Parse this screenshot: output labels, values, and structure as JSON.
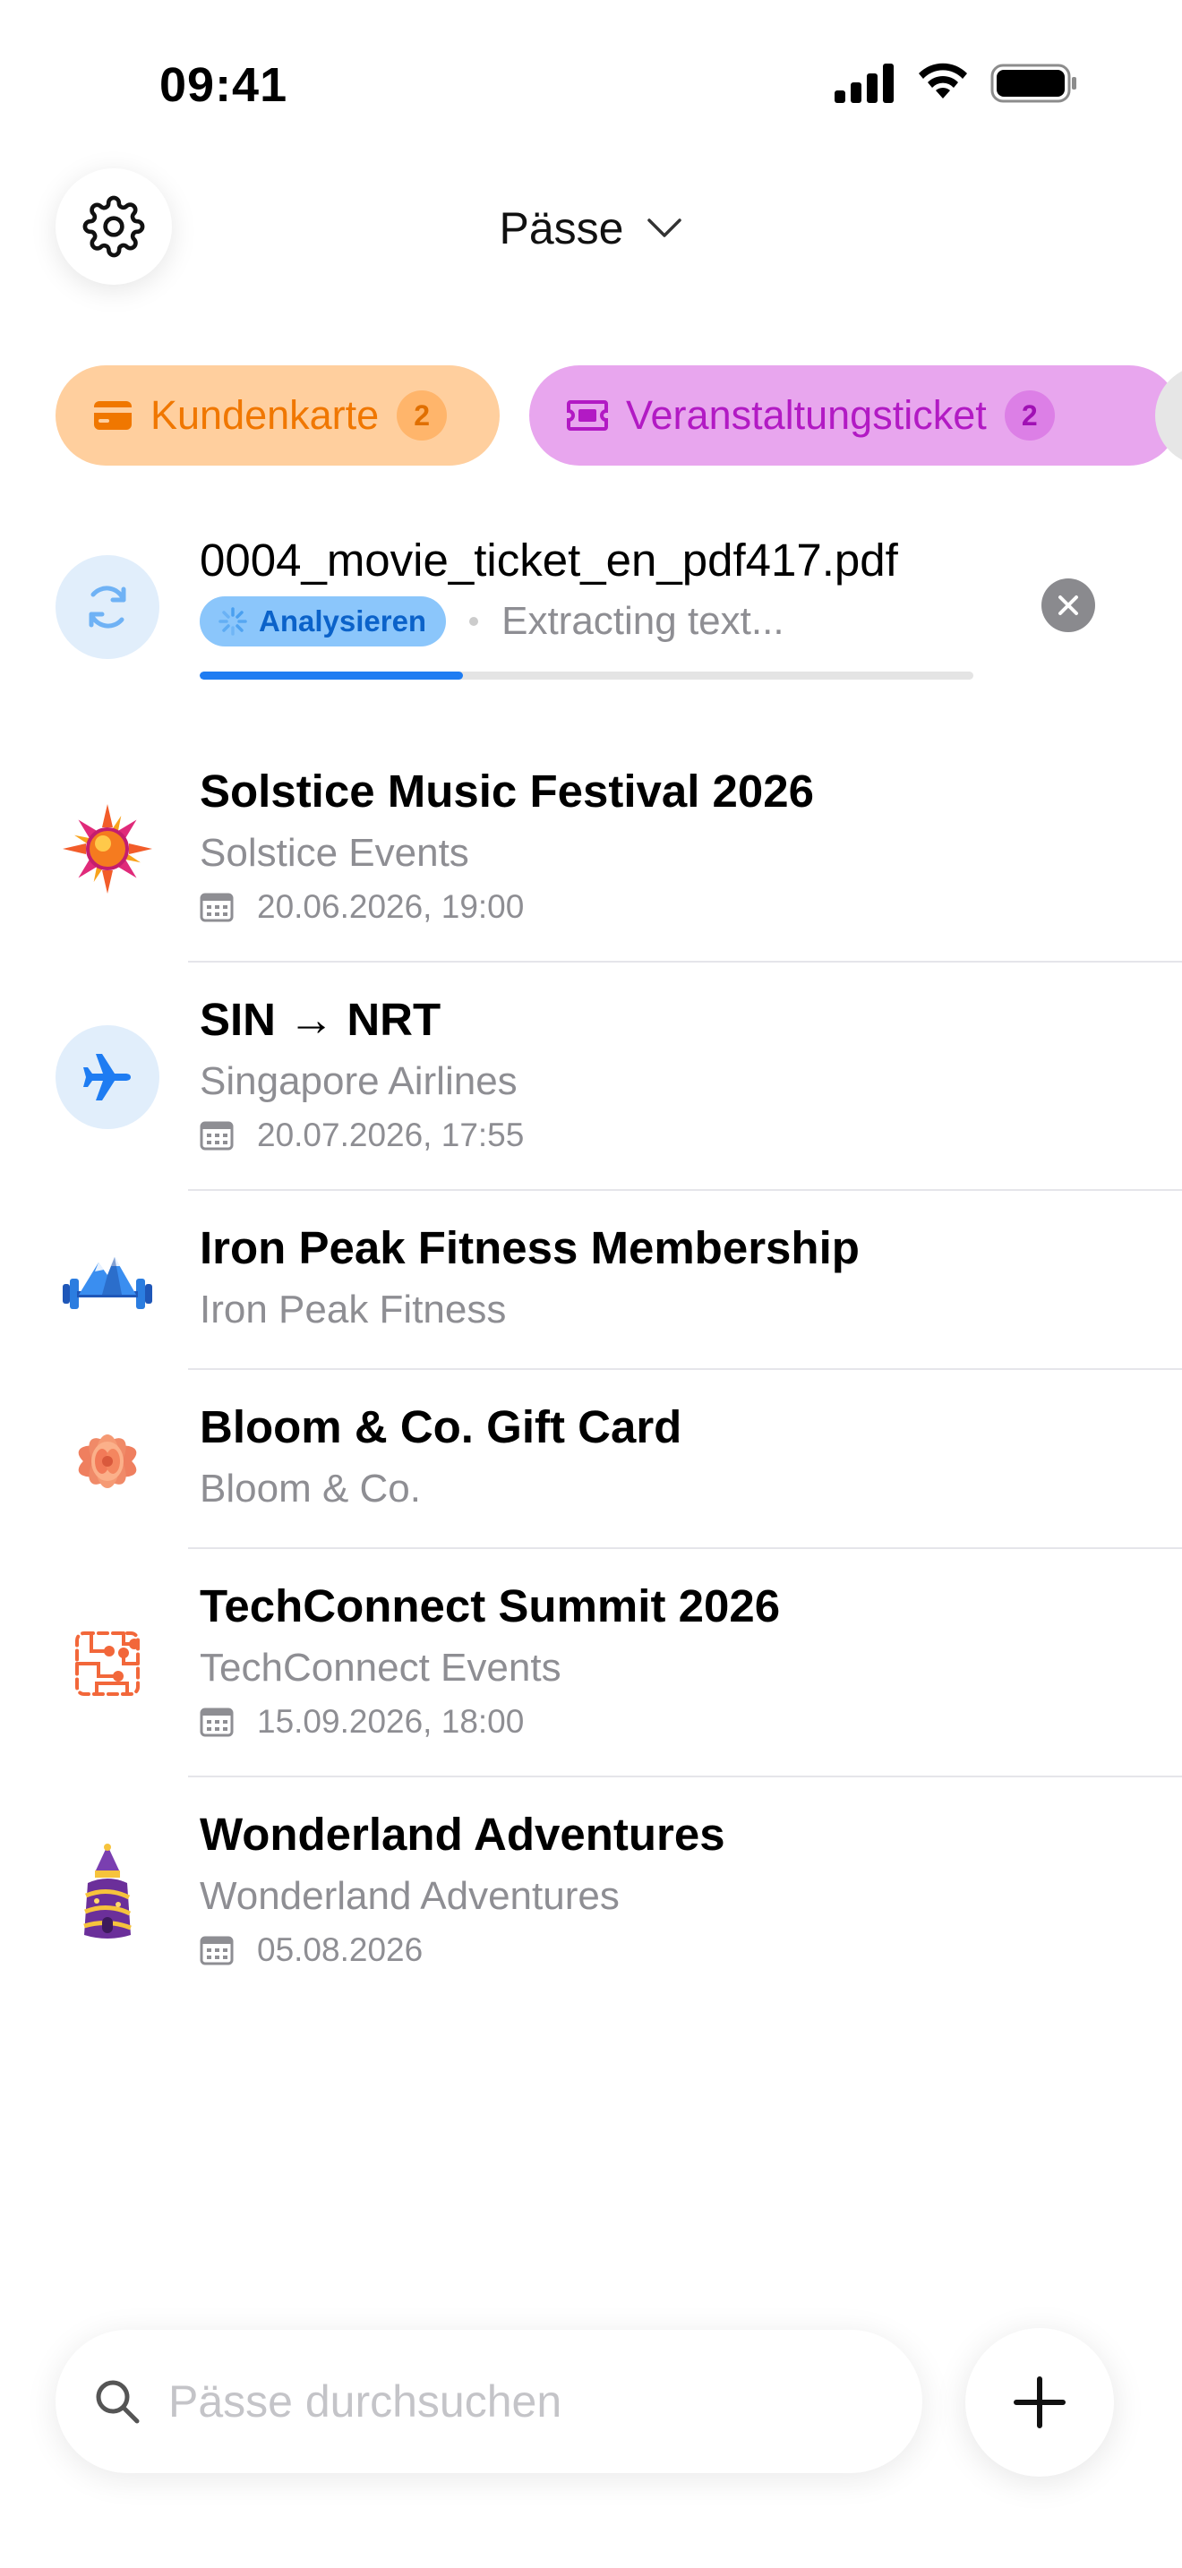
{
  "status_bar": {
    "time": "09:41"
  },
  "header": {
    "title": "Pässe"
  },
  "filters": [
    {
      "label": "Kundenkarte",
      "count": "2"
    },
    {
      "label": "Veranstaltungsticket",
      "count": "2"
    }
  ],
  "processing": {
    "filename": "0004_movie_ticket_en_pdf417.pdf",
    "badge": "Analysieren",
    "detail": "Extracting text...",
    "progress_percent": 34
  },
  "passes": [
    {
      "title": "Solstice Music Festival 2026",
      "subtitle": "Solstice Events",
      "date": "20.06.2026, 19:00",
      "icon": "sun-logo-icon"
    },
    {
      "title": "SIN → NRT",
      "subtitle": "Singapore Airlines",
      "date": "20.07.2026, 17:55",
      "icon": "airplane-icon"
    },
    {
      "title": "Iron Peak Fitness Membership",
      "subtitle": "Iron Peak Fitness",
      "icon": "mountain-dumbbell-logo-icon"
    },
    {
      "title": "Bloom & Co. Gift Card",
      "subtitle": "Bloom & Co.",
      "icon": "flower-logo-icon"
    },
    {
      "title": "TechConnect Summit 2026",
      "subtitle": "TechConnect Events",
      "date": "15.09.2026, 18:00",
      "icon": "circuit-logo-icon"
    },
    {
      "title": "Wonderland Adventures",
      "subtitle": "Wonderland Adventures",
      "date": "05.08.2026",
      "icon": "castle-logo-icon"
    }
  ],
  "search": {
    "placeholder": "Pässe durchsuchen"
  },
  "colors": {
    "accent_blue": "#1e7cf2",
    "customer_card_bg": "#ffcf9e",
    "customer_card_text": "#f07700",
    "event_ticket_bg": "#e8a6ee",
    "event_ticket_text": "#b21ac4"
  }
}
